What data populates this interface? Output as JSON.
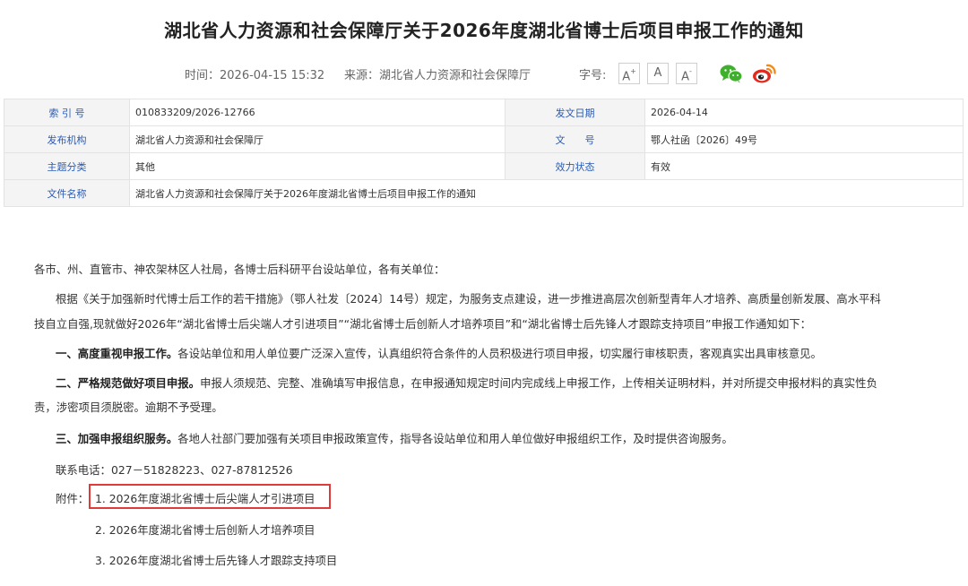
{
  "article": {
    "title": "湖北省人力资源和社会保障厅关于2026年度湖北省博士后项目申报工作的通知",
    "time_text": "时间：2026-04-15 15:32",
    "source_text": "来源：湖北省人力资源和社会保障厅",
    "font_size_label": "字号:",
    "font_large": "A",
    "font_large_sup": "+",
    "font_mid": "A",
    "font_small": "A",
    "font_small_sup": "-"
  },
  "info_table": {
    "index_key": "索 引 号",
    "index_val": "010833209/2026-12766",
    "date_key": "发文日期",
    "date_val": "2026-04-14",
    "org_key": "发布机构",
    "org_val": "湖北省人力资源和社会保障厅",
    "docno_key": "文　　号",
    "docno_val": "鄂人社函〔2026〕49号",
    "topic_key": "主题分类",
    "topic_val": "其他",
    "status_key": "效力状态",
    "status_val": "有效",
    "filename_key": "文件名称",
    "filename_val": "湖北省人力资源和社会保障厅关于2026年度湖北省博士后项目申报工作的通知"
  },
  "content": {
    "greeting": "各市、州、直管市、神农架林区人社局，各博士后科研平台设站单位，各有关单位：",
    "intro_line1": "根据《关于加强新时代博士后工作的若干措施》（鄂人社发〔2024〕14号）规定，为服务支点建设，进一步推进高层次创新型青年人才培养、高质量创新发展、高水平科",
    "intro_line2": "技自立自强,现就做好2026年“湖北省博士后尖端人才引进项目”“湖北省博士后创新人才培养项目”和“湖北省博士后先锋人才跟踪支持项目”申报工作通知如下：",
    "item1_bold": "一、高度重视申报工作。",
    "item1_text": "各设站单位和用人单位要广泛深入宣传，认真组织符合条件的人员积极进行项目申报，切实履行审核职责，客观真实出具审核意见。",
    "item2_bold": "二、严格规范做好项目申报。",
    "item2_text_line1": "申报人须规范、完整、准确填写申报信息，在申报通知规定时间内完成线上申报工作，上传相关证明材料，并对所提交申报材料的真实性负",
    "item2_text_line2": "责，涉密项目须脱密。逾期不予受理。",
    "item3_bold": "三、加强申报组织服务。",
    "item3_text": "各地人社部门要加强有关项目申报政策宣传，指导各设站单位和用人单位做好申报组织工作，及时提供咨询服务。",
    "phone": "联系电话：027－51828223、027-87812526",
    "attach_label": "附件：",
    "attachments": [
      "1. 2026年度湖北省博士后尖端人才引进项目",
      "2. 2026年度湖北省博士后创新人才培养项目",
      "3. 2026年度湖北省博士后先锋人才跟踪支持项目"
    ]
  },
  "colors": {
    "highlight_border": "#e03b3b",
    "label_blue": "#2a5bb5",
    "wechat_green": "#3fb02c",
    "weibo_orange": "#f08a1c",
    "weibo_red": "#e2291d"
  },
  "icons": {
    "share_wechat": "wechat-icon",
    "share_weibo": "weibo-icon"
  }
}
